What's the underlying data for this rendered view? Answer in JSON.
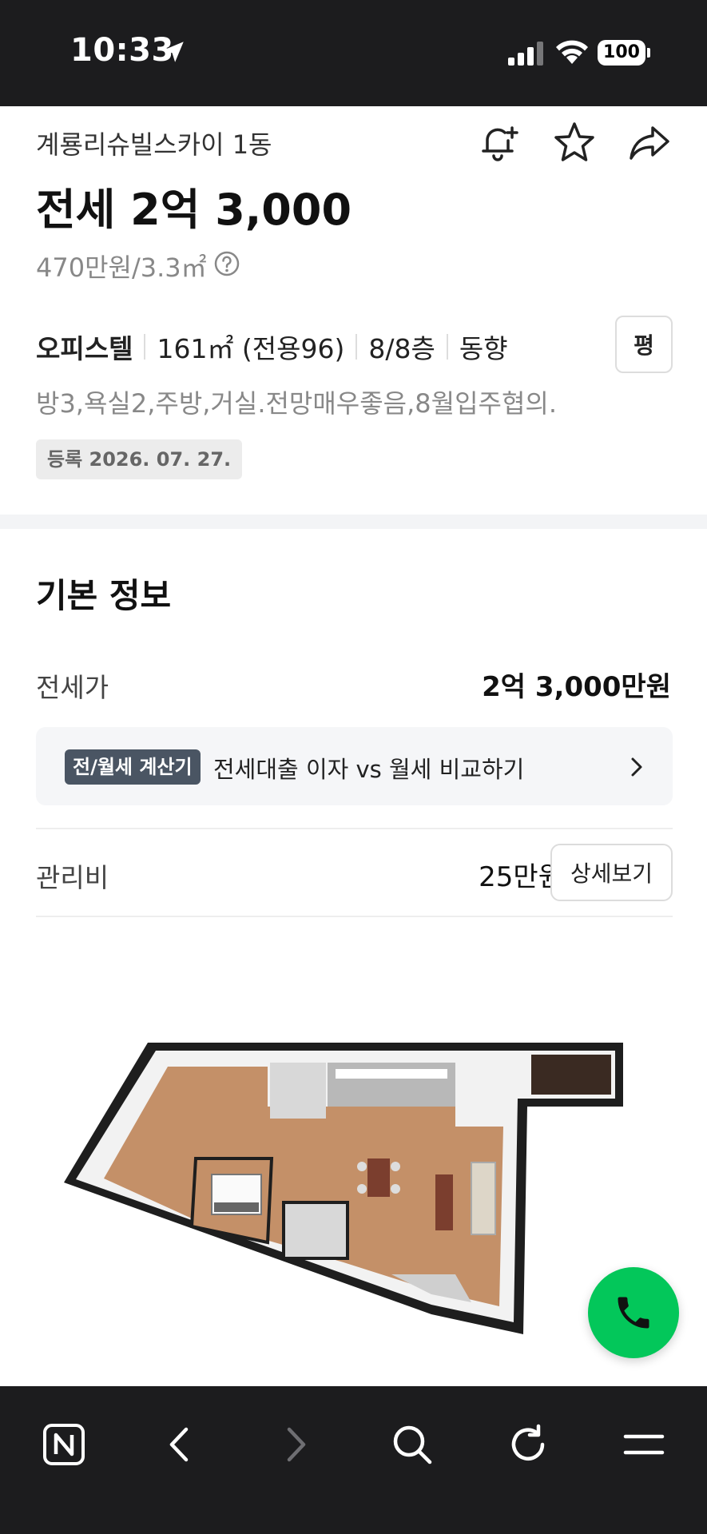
{
  "status_bar": {
    "time": "10:33",
    "battery": "100"
  },
  "header": {
    "building_name": "계룡리슈빌스카이 1동",
    "price_title": "전세 2억 3,000",
    "unit_price": "470만원/3.3㎡"
  },
  "specs": {
    "type": "오피스텔",
    "area": "161㎡ (전용96)",
    "floor": "8/8층",
    "direction": "동향",
    "pyeong_button": "평"
  },
  "description": "방3,욕실2,주방,거실.전망매우좋음,8월입주협의.",
  "registered": "등록 2026. 07. 27.",
  "basic_info": {
    "title": "기본 정보",
    "jeonse_label": "전세가",
    "jeonse_value": "2억 3,000만원",
    "calc_badge": "전/월세 계산기",
    "calc_text": "전세대출 이자 vs 월세 비교하기",
    "mgmt_label": "관리비",
    "mgmt_value": "25만원",
    "detail_button": "상세보기"
  },
  "colors": {
    "accent_green": "#03c75a",
    "dark_bar": "#1c1c1e",
    "badge_dark": "#4a5563"
  },
  "icons": [
    "location-arrow-icon",
    "signal-icon",
    "wifi-icon",
    "battery-icon",
    "bell-plus-icon",
    "star-icon",
    "share-icon",
    "help-icon",
    "chevron-right-icon",
    "phone-icon",
    "naver-n-icon",
    "back-icon",
    "forward-icon",
    "search-icon",
    "reload-icon",
    "menu-icon"
  ]
}
